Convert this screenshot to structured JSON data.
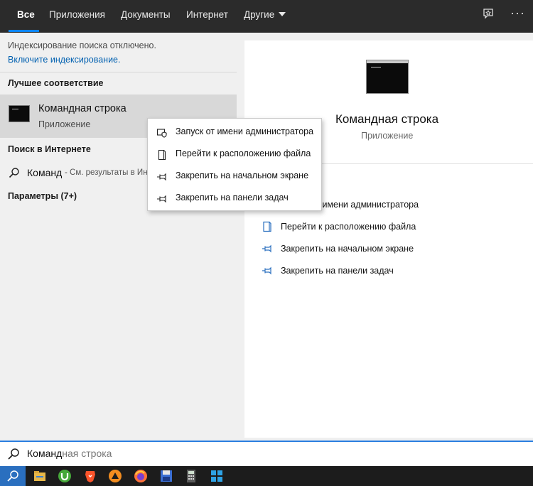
{
  "tabs": [
    {
      "label": "Все"
    },
    {
      "label": "Приложения"
    },
    {
      "label": "Документы"
    },
    {
      "label": "Интернет"
    },
    {
      "label": "Другие"
    }
  ],
  "left": {
    "indexing_notice": "Индексирование поиска отключено.",
    "indexing_link": "Включите индексирование.",
    "best_match_header": "Лучшее соответствие",
    "best_match_title": "Командная строка",
    "best_match_subtitle": "Приложение",
    "web_header": "Поиск в Интернете",
    "web_query": "Команд",
    "web_hint": "- См. результаты в Инте",
    "settings_header": "Параметры (7+)"
  },
  "context_menu": [
    {
      "label": "Запуск от имени администратора",
      "icon": "shield-icon"
    },
    {
      "label": "Перейти к расположению файла",
      "icon": "file-location-icon"
    },
    {
      "label": "Закрепить на начальном экране",
      "icon": "pin-icon"
    },
    {
      "label": "Закрепить на панели задач",
      "icon": "pin-icon"
    }
  ],
  "preview": {
    "title": "Командная строка",
    "subtitle": "Приложение",
    "actions": [
      {
        "label": "Запуск от имени администратора",
        "icon": "shield-icon"
      },
      {
        "label": "Перейти к расположению файла",
        "icon": "file-location-icon"
      },
      {
        "label": "Закрепить на начальном экране",
        "icon": "pin-icon"
      },
      {
        "label": "Закрепить на панели задач",
        "icon": "pin-icon"
      }
    ]
  },
  "search": {
    "typed": "Команд",
    "suggestion_rest": "ная строка"
  },
  "taskbar_icons": [
    "search-icon",
    "file-explorer-icon",
    "utorrent-icon",
    "brave-icon",
    "aimp-icon",
    "firefox-icon",
    "floppy-icon",
    "calculator-icon",
    "grid-app-icon"
  ],
  "colors": {
    "accent": "#0a84ff",
    "link": "#0060b0",
    "topbar": "#2b2b2b"
  }
}
